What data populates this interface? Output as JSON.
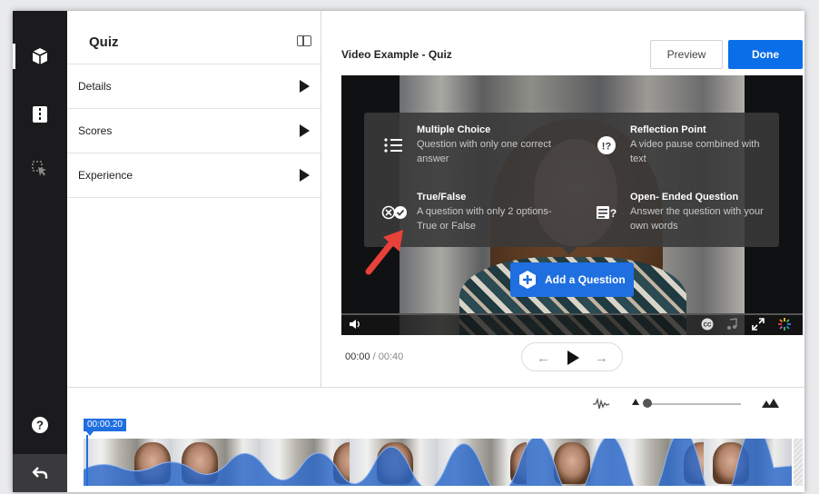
{
  "sidebar_panel": {
    "title": "Quiz",
    "items": [
      {
        "label": "Details"
      },
      {
        "label": "Scores"
      },
      {
        "label": "Experience"
      }
    ]
  },
  "header": {
    "video_title": "Video Example - Quiz",
    "preview_label": "Preview",
    "done_label": "Done"
  },
  "question_menu": {
    "options": [
      {
        "title": "Multiple Choice",
        "description": "Question with only one correct answer",
        "icon": "list-icon"
      },
      {
        "title": "Reflection Point",
        "description": "A video pause combined with text",
        "icon": "reflection-icon"
      },
      {
        "title": "True/False",
        "description": "A question with only 2 options- True or False",
        "icon": "true-false-icon"
      },
      {
        "title": "Open- Ended Question",
        "description": "Answer the question with your own words",
        "icon": "open-ended-icon"
      }
    ],
    "add_button_label": "Add a Question"
  },
  "player": {
    "current_time": "00:00",
    "separator": "/",
    "total_time": "00:40"
  },
  "timeline": {
    "playhead_time": "00:00.20"
  },
  "colors": {
    "accent": "#1f6fe0",
    "done_button": "#0a6ee8",
    "rail": "#1b1b1d",
    "annotation_arrow": "#e8413a"
  }
}
